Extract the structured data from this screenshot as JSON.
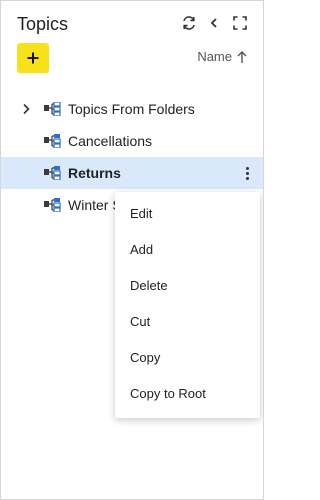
{
  "header": {
    "title": "Topics",
    "icons": [
      "refresh-icon",
      "collapse-left-icon",
      "expand-icon"
    ]
  },
  "toolbar": {
    "add_label": "+",
    "sort_label": "Name",
    "sort_icon": "arrow-up-icon"
  },
  "tree": {
    "items": [
      {
        "label": "Topics From Folders",
        "expandable": true
      },
      {
        "label": "Cancellations"
      },
      {
        "label": "Returns",
        "selected": true
      },
      {
        "label": "Winter S"
      }
    ]
  },
  "context_menu": {
    "items": [
      {
        "label": "Edit"
      },
      {
        "label": "Add"
      },
      {
        "label": "Delete"
      },
      {
        "label": "Cut"
      },
      {
        "label": "Copy"
      },
      {
        "label": "Copy to Root"
      }
    ]
  },
  "colors": {
    "accent_yellow": "#f7e11a",
    "selected_row": "#d9e9fb",
    "icon_blue": "#2f6fc4"
  }
}
